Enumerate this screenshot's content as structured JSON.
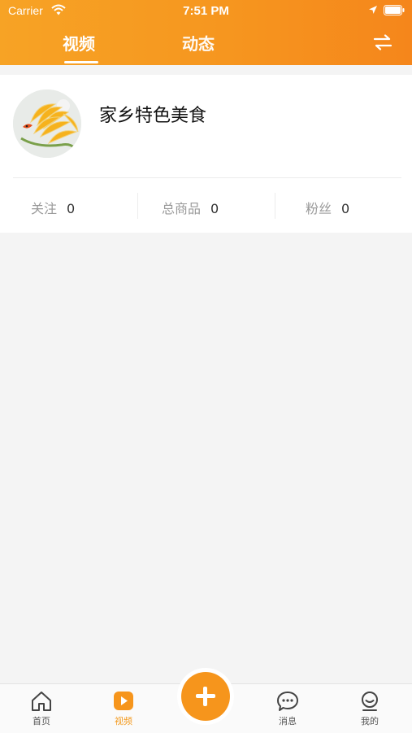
{
  "status_bar": {
    "carrier": "Carrier",
    "time": "7:51 PM"
  },
  "tabs": [
    {
      "label": "视频",
      "active": true
    },
    {
      "label": "动态",
      "active": false
    }
  ],
  "profile": {
    "name": "家乡特色美食",
    "stats": [
      {
        "label": "关注",
        "value": "0"
      },
      {
        "label": "总商品",
        "value": "0"
      },
      {
        "label": "粉丝",
        "value": "0"
      }
    ]
  },
  "bottom_nav": [
    {
      "label": "首页",
      "icon": "home-icon",
      "active": false
    },
    {
      "label": "视频",
      "icon": "video-icon",
      "active": true
    },
    {
      "label": "消息",
      "icon": "message-icon",
      "active": false
    },
    {
      "label": "我的",
      "icon": "mine-icon",
      "active": false
    }
  ],
  "colors": {
    "accent": "#f6951c",
    "header_start": "#f7a325",
    "header_end": "#f5861b",
    "background": "#f4f4f4"
  }
}
